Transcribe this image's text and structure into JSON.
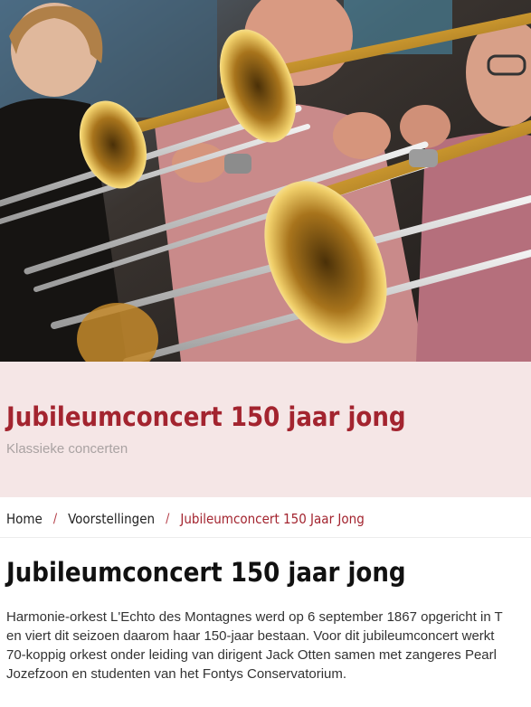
{
  "hero": {
    "title": "Jubileumconcert 150 jaar jong",
    "subtitle": "Klassieke concerten"
  },
  "breadcrumb": {
    "items": [
      "Home",
      "Voorstellingen"
    ],
    "separator": "/",
    "current": "Jubileumconcert 150 Jaar Jong"
  },
  "article": {
    "title": "Jubileumconcert 150 jaar jong",
    "lines": [
      "Harmonie-orkest L'Echto des Montagnes werd op 6 september 1867 opgericht in T",
      "en viert dit seizoen daarom haar 150-jaar bestaan. Voor dit jubileumconcert werkt",
      "70-koppig orkest onder leiding van dirigent Jack Otten samen met zangeres Pearl",
      "Jozefzoon en studenten van het Fontys Conservatorium."
    ]
  },
  "colors": {
    "accent": "#a3242f",
    "banner_bg": "#f5e6e6",
    "subtitle": "#a9a2a2"
  }
}
